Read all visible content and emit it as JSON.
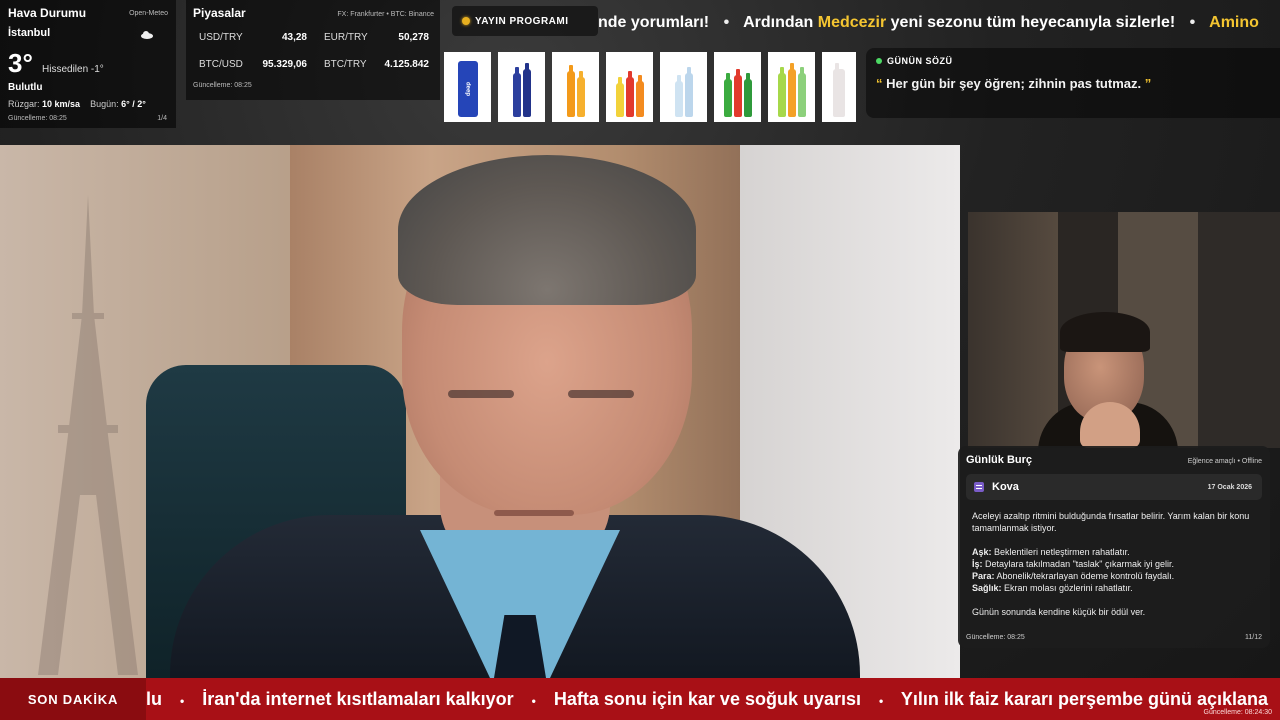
{
  "weather": {
    "title": "Hava Durumu",
    "source": "Open-Meteo",
    "city": "İstanbul",
    "temperature": "3°",
    "feels_like": "Hissedilen -1°",
    "condition": "Bulutlu",
    "wind_label": "Rüzgar:",
    "wind_value": "10 km/sa",
    "today_label": "Bugün:",
    "today_value": "6° / 2°",
    "updated": "Güncelleme: 08:25",
    "page": "1/4",
    "icon": "cloud-icon"
  },
  "markets": {
    "title": "Piyasalar",
    "source": "FX: Frankfurter • BTC: Binance",
    "rates": [
      {
        "symbol": "USD/TRY",
        "value": "43,28"
      },
      {
        "symbol": "EUR/TRY",
        "value": "50,278"
      },
      {
        "symbol": "BTC/USD",
        "value": "95.329,06"
      },
      {
        "symbol": "BTC/TRY",
        "value": "4.125.842"
      }
    ],
    "updated": "Güncelleme: 08:25"
  },
  "program_button": {
    "label": "YAYIN PROGRAMI",
    "dot_color": "#e8b020"
  },
  "top_ticker": {
    "part1": "nde yorumları!",
    "part2_pre": "Ardından",
    "part2_hl": "Medcezir",
    "part2_post": "yeni sezonu tüm heyecanıyla sizlerle!",
    "part3": "Amino",
    "separator": "•",
    "highlight_color": "#f4c531"
  },
  "quote": {
    "title": "GÜNÜN SÖZÜ",
    "open_mark": "“",
    "text": "Her gün bir şey öğren; zihnin pas tutmaz.",
    "close_mark": "”"
  },
  "products": [
    {
      "name": "deep-can",
      "label": "deep"
    },
    {
      "name": "blue-bottles"
    },
    {
      "name": "orange-bottles"
    },
    {
      "name": "mixed-soda-bottles"
    },
    {
      "name": "water-bottles"
    },
    {
      "name": "green-soda-bottles"
    },
    {
      "name": "fruit-soda-bottles"
    },
    {
      "name": "clear-bottle"
    }
  ],
  "horoscope": {
    "title": "Günlük Burç",
    "meta": "Eğlence amaçlı • Offline",
    "sign": "Kova",
    "date": "17 Ocak 2026",
    "intro": "Aceleyi azaltıp ritmini bulduğunda fırsatlar belirir. Yarım kalan bir konu tamamlanmak istiyor.",
    "love_label": "Aşk:",
    "love_text": "Beklentileri netleştirmen rahatlatır.",
    "work_label": "İş:",
    "work_text": "Detaylara takılmadan \"taslak\" çıkarmak iyi gelir.",
    "money_label": "Para:",
    "money_text": "Abonelik/tekrarlayan ödeme kontrolü faydalı.",
    "health_label": "Sağlık:",
    "health_text": "Ekran molası gözlerini rahatlatır.",
    "closing": "Günün sonunda kendine küçük bir ödül ver.",
    "updated": "Güncelleme: 08:25",
    "page": "11/12"
  },
  "breaking_news": {
    "label": "SON DAKİKA",
    "items": [
      "lu",
      "İran'da internet kısıtlamaları kalkıyor",
      "Hafta sonu için kar ve soğuk uyarısı",
      "Yılın ilk faiz kararı perşembe günü açıklana"
    ],
    "separator": "•",
    "clock": "Güncelleme: 08:24:30"
  }
}
